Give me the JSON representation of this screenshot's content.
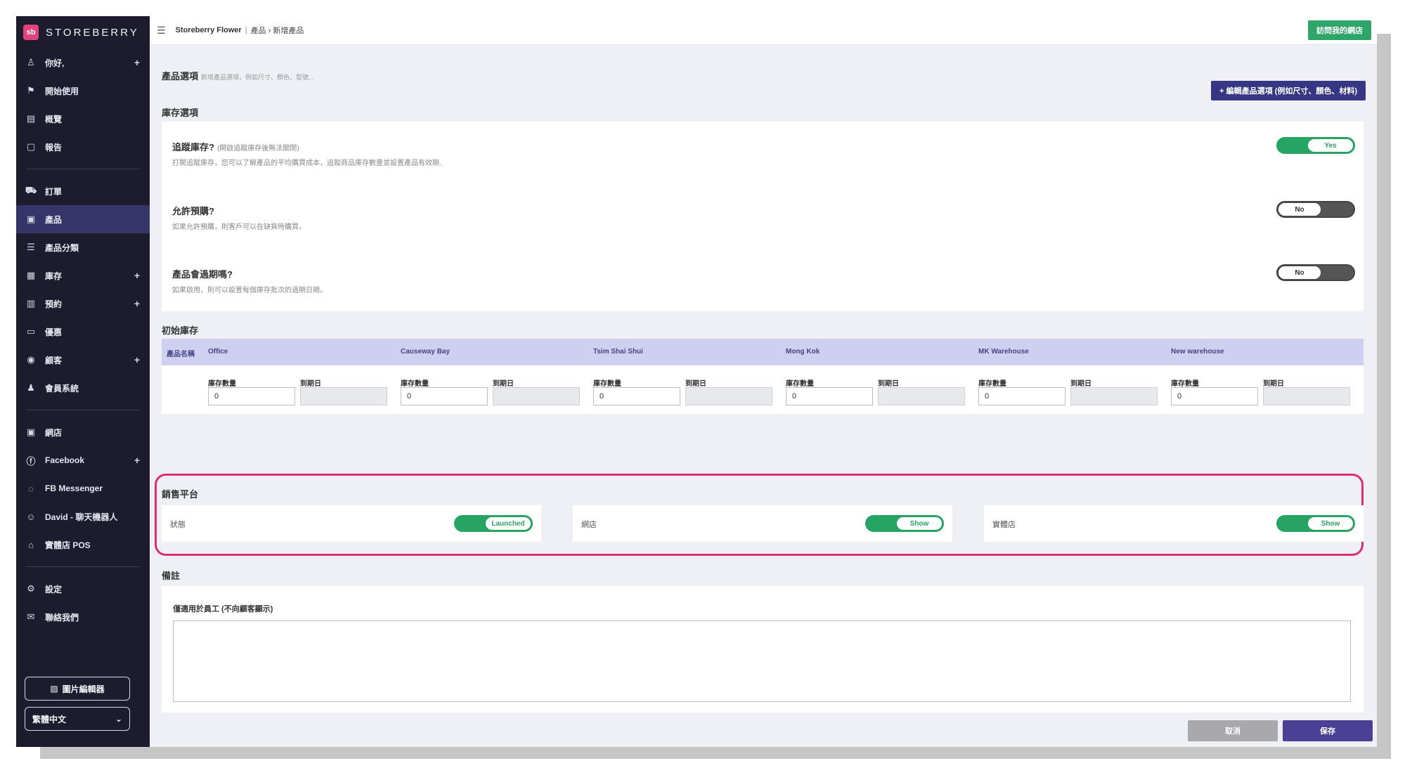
{
  "brand": {
    "logo": "sb",
    "name": "STOREBERRY"
  },
  "sidebar": {
    "groups": [
      [
        {
          "icon": "user-icon",
          "glyph": "♙",
          "label": "你好,",
          "plus": true
        },
        {
          "icon": "flag-icon",
          "glyph": "⚑",
          "label": "開始使用",
          "plus": false
        },
        {
          "icon": "chart-icon",
          "glyph": "▤",
          "label": "概覽",
          "plus": false
        },
        {
          "icon": "report-icon",
          "glyph": "▢",
          "label": "報告",
          "plus": false
        }
      ],
      [
        {
          "icon": "cart-icon",
          "glyph": "⛟",
          "label": "訂單",
          "plus": false
        },
        {
          "icon": "product-icon",
          "glyph": "▣",
          "label": "產品",
          "plus": false,
          "active": true
        },
        {
          "icon": "category-icon",
          "glyph": "☰",
          "label": "產品分類",
          "plus": false
        },
        {
          "icon": "inventory-icon",
          "glyph": "▦",
          "label": "庫存",
          "plus": true
        },
        {
          "icon": "calendar-icon",
          "glyph": "▥",
          "label": "預約",
          "plus": true
        },
        {
          "icon": "coupon-icon",
          "glyph": "▭",
          "label": "優惠",
          "plus": false
        },
        {
          "icon": "customer-icon",
          "glyph": "◉",
          "label": "顧客",
          "plus": true
        },
        {
          "icon": "member-icon",
          "glyph": "♟",
          "label": "會員系統",
          "plus": false
        }
      ],
      [
        {
          "icon": "shop-icon",
          "glyph": "▣",
          "label": "網店",
          "plus": false
        },
        {
          "icon": "facebook-icon",
          "glyph": "ⓕ",
          "label": "Facebook",
          "plus": true
        },
        {
          "icon": "messenger-icon",
          "glyph": "◌",
          "label": "FB Messenger",
          "plus": false
        },
        {
          "icon": "bot-icon",
          "glyph": "☺",
          "label": "David - 聊天機器人",
          "plus": false
        },
        {
          "icon": "pos-icon",
          "glyph": "⌂",
          "label": "實體店 POS",
          "plus": false
        }
      ],
      [
        {
          "icon": "settings-icon",
          "glyph": "⚙",
          "label": "設定",
          "plus": false
        },
        {
          "icon": "contact-icon",
          "glyph": "✉",
          "label": "聯絡我們",
          "plus": false
        }
      ]
    ],
    "editor_button": "圖片編輯器",
    "language": "繁體中文"
  },
  "topbar": {
    "store": "Storeberry Flower",
    "sep": "|",
    "path": "產品 › 新增產品",
    "visit_button": "訪問我的網店"
  },
  "product_options": {
    "title": "產品選項",
    "subtitle": "新增產品選項，例如尺寸、顏色、型號...",
    "button": "+ 編輯產品選項 (例如尺寸、顏色、材料)"
  },
  "inventory_options": {
    "title": "庫存選項",
    "rows": [
      {
        "title": "追蹤庫存?",
        "note": "(開啟追蹤庫存後無法關閉)",
        "desc": "打開追蹤庫存，您可以了解產品的平均購買成本，追蹤商品庫存數量並設置產品有效期.",
        "state": "on",
        "value": "Yes"
      },
      {
        "title": "允許預購?",
        "note": "",
        "desc": "如果允許預購，則客戶可以在缺貨時購買。",
        "state": "off",
        "value": "No"
      },
      {
        "title": "產品會過期嗎?",
        "note": "",
        "desc": "如果啟用，則可以設置每個庫存批次的過期日期。",
        "state": "off",
        "value": "No"
      }
    ]
  },
  "initial_stock": {
    "title": "初始庫存",
    "name_header": "產品名稱",
    "qty_label": "庫存數量",
    "expiry_label": "到期日",
    "locations": [
      {
        "name": "Office",
        "qty": "0"
      },
      {
        "name": "Causeway Bay",
        "qty": "0"
      },
      {
        "name": "Tsim Shai Shui",
        "qty": "0"
      },
      {
        "name": "Mong Kok",
        "qty": "0"
      },
      {
        "name": "MK Warehouse",
        "qty": "0"
      },
      {
        "name": "New warehouse",
        "qty": "0"
      }
    ]
  },
  "sales_platforms": {
    "title": "銷售平台",
    "items": [
      {
        "label": "狀態",
        "value": "Launched"
      },
      {
        "label": "網店",
        "value": "Show"
      },
      {
        "label": "實體店",
        "value": "Show"
      }
    ]
  },
  "notes": {
    "title": "備註",
    "label": "僅適用於員工 (不向顧客顯示)",
    "value": ""
  },
  "footer": {
    "cancel": "取消",
    "save": "保存"
  },
  "colors": {
    "accent": "#363684",
    "success": "#27a463",
    "highlight": "#d9316e",
    "sidebar": "#1c1c2e"
  }
}
